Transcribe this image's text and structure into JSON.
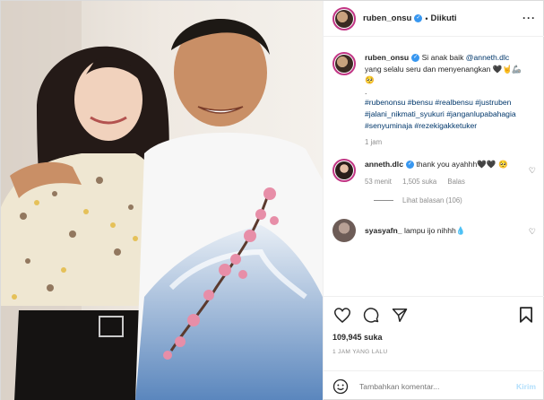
{
  "post": {
    "username": "ruben_onsu",
    "follow_status": "Diikuti",
    "more_icon": "more-horizontal-icon"
  },
  "caption": {
    "username": "ruben_onsu",
    "text_before_tag": " Si anak baik ",
    "mention": "@anneth.dlc",
    "text_after": " yang selalu seru dan menyenangkan 🖤🤘🦾🥺",
    "dot": ".",
    "hashtags": "#rubenonsu #bensu #realbensu #justruben #jalani_nikmati_syukuri #janganlupabahagia #senyuminaja #rezekigakketuker",
    "time": "1 jam"
  },
  "comments": [
    {
      "username": "anneth.dlc",
      "text": " thank you ayahhh🖤🖤 🥺",
      "time": "53 menit",
      "likes": "1,505 suka",
      "reply": "Balas",
      "view_replies": "Lihat balasan (106)"
    },
    {
      "username": "syasyafn_",
      "text": " lampu ijo nihhh💧"
    }
  ],
  "actions": {
    "likes": "109,945 suka",
    "timestamp": "1 JAM YANG LALU"
  },
  "add_comment": {
    "placeholder": "Tambahkan komentar...",
    "post_label": "Kirim"
  }
}
